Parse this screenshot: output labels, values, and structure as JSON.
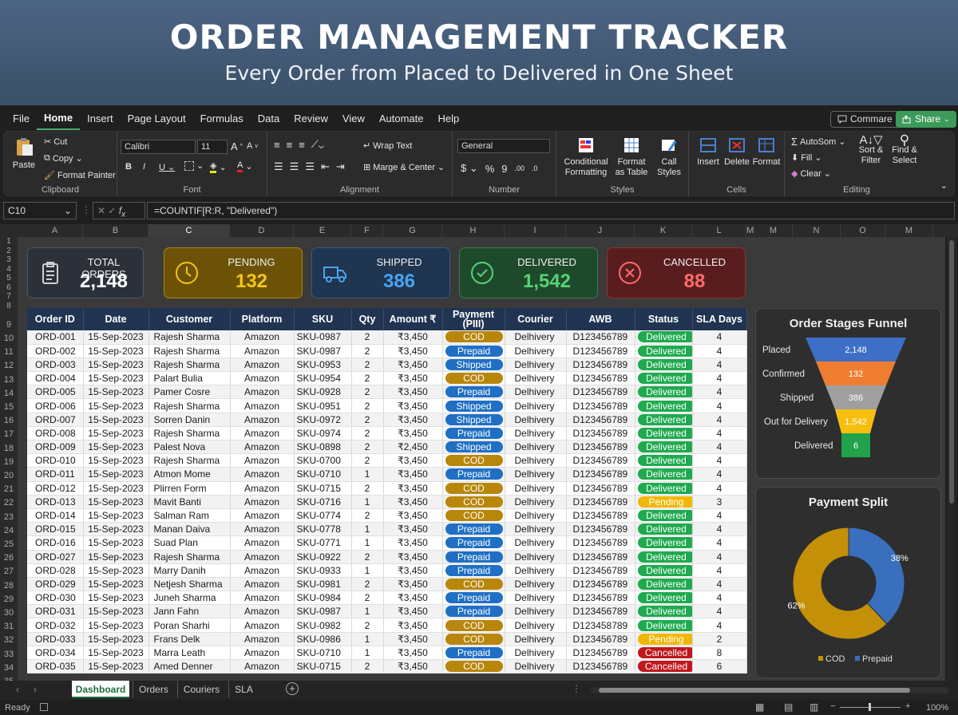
{
  "banner": {
    "title": "ORDER MANAGEMENT TRACKER",
    "subtitle": "Every Order from Placed to Delivered in One Sheet"
  },
  "menu": [
    "File",
    "Home",
    "Insert",
    "Page Layout",
    "Formulas",
    "Data",
    "Review",
    "View",
    "Automate",
    "Help"
  ],
  "comments_label": "Commare",
  "share_label": "Share",
  "ribbon": {
    "clipboard": {
      "paste": "Paste",
      "cut": "Cut",
      "copy": "Copy",
      "format_painter": "Format Painter",
      "label": "Clipboard"
    },
    "font": {
      "name": "Calibri",
      "size": "11",
      "label": "Font"
    },
    "alignment": {
      "wrap": "Wrap Text",
      "merge": "Marge & Center",
      "label": "Alignment"
    },
    "number": {
      "format": "General",
      "label": "Number"
    },
    "styles": {
      "conditional": "Conditional Formatting",
      "format_table": "Format as Table",
      "cell_styles": "Call Styles",
      "label": "Styles"
    },
    "cells": {
      "insert": "Insert",
      "delete": "Delete",
      "format": "Format",
      "label": "Cells"
    },
    "editing": {
      "autosum": "AutoSom",
      "fill": "Fill",
      "clear": "Clear",
      "sort": "Sort & Filter",
      "find": "Find & Select",
      "label": "Editing"
    }
  },
  "namebox": "C10",
  "formula": "=COUNTIF[R:R, \"Delivered\")",
  "columns": [
    "A",
    "B",
    "C",
    "D",
    "E",
    "F",
    "G",
    "H",
    "I",
    "J",
    "K",
    "L",
    "M",
    "M",
    "N",
    "O",
    "M"
  ],
  "cards": [
    {
      "label": "TOTAL ORDERS",
      "value": "2,148",
      "bg": "#2b3039",
      "border": "#505866",
      "color": "#ffffff",
      "icon": "clipboard-icon"
    },
    {
      "label": "PENDING",
      "value": "132",
      "bg": "#6b5206",
      "border": "#a88512",
      "color": "#f5c518",
      "icon": "clock-icon"
    },
    {
      "label": "SHIPPED",
      "value": "386",
      "bg": "#1f3550",
      "border": "#3a5a82",
      "color": "#4aa3f0",
      "icon": "truck-icon"
    },
    {
      "label": "DELIVERED",
      "value": "1,542",
      "bg": "#1e4a2c",
      "border": "#3b7a4f",
      "color": "#58d277",
      "icon": "check-icon"
    },
    {
      "label": "CANCELLED",
      "value": "88",
      "bg": "#5a1d1f",
      "border": "#8a3538",
      "color": "#ff6b6b",
      "icon": "x-circle-icon"
    }
  ],
  "table": {
    "headers": [
      "Order ID",
      "Date",
      "Customer",
      "Platform",
      "SKU",
      "Qty",
      "Amount ₹",
      "Payment (PIII)",
      "Courier",
      "AWB",
      "Status",
      "SLA Days"
    ],
    "rows": [
      [
        "ORD-001",
        "15-Sep-2023",
        "Rajesh Sharma",
        "Amazon",
        "SKU-0987",
        "2",
        "₹3,450",
        "COD",
        "Delhivery",
        "D123456789",
        "Delivered",
        "4"
      ],
      [
        "ORD-002",
        "15-Sep-2023",
        "Rajesh Sharma",
        "Amazon",
        "SKU-0987",
        "2",
        "₹3,450",
        "Prepaid",
        "Delhivery",
        "D123456789",
        "Delivered",
        "4"
      ],
      [
        "ORD-003",
        "15-Sep-2023",
        "Rajesh Sharma",
        "Amazon",
        "SKU-0953",
        "2",
        "₹3,450",
        "Shipped",
        "Delhivery",
        "D123456789",
        "Delivered",
        "4"
      ],
      [
        "ORD-004",
        "15-Sep-2023",
        "Palart Bulia",
        "Amazon",
        "SKU-0954",
        "2",
        "₹3,450",
        "COD",
        "Delhivery",
        "D123456789",
        "Delivered",
        "4"
      ],
      [
        "ORD-005",
        "15-Sep-2023",
        "Pamer Cosre",
        "Amazon",
        "SKU-0928",
        "2",
        "₹3,450",
        "Prepaid",
        "Delhivery",
        "D123456789",
        "Delivered",
        "4"
      ],
      [
        "ORD-006",
        "15-Sep-2023",
        "Rajesh Sharma",
        "Amazon",
        "SKU-0951",
        "2",
        "₹3,450",
        "Shipped",
        "Delhivery",
        "D123456789",
        "Delivered",
        "4"
      ],
      [
        "ORD-007",
        "15-Sep-2023",
        "Sorren Danin",
        "Amazon",
        "SKU-0972",
        "2",
        "₹3,450",
        "Shipped",
        "Delhivery",
        "D123456789",
        "Delivered",
        "4"
      ],
      [
        "ORD-008",
        "15-Sep-2023",
        "Rajesh Sharma",
        "Amazon",
        "SKU-0974",
        "2",
        "₹3,450",
        "Prepaid",
        "Delhivery",
        "D123456789",
        "Delivered",
        "4"
      ],
      [
        "ORD-009",
        "15-Sep-2023",
        "Palest Nova",
        "Amazon",
        "SKU-0898",
        "2",
        "₹2,450",
        "Shipped",
        "Delhivery",
        "D123456789",
        "Delivered",
        "4"
      ],
      [
        "ORD-010",
        "15-Sep-2023",
        "Rajesh Sharma",
        "Amazon",
        "SKU-0700",
        "2",
        "₹3,450",
        "COD",
        "Delhivery",
        "D123456789",
        "Delivered",
        "4"
      ],
      [
        "ORD-011",
        "15-Sep-2023",
        "Atmon Mome",
        "Amazon",
        "SKU-0710",
        "1",
        "₹3,450",
        "Prepaid",
        "Delhivery",
        "D123456789",
        "Delivered",
        "4"
      ],
      [
        "ORD-012",
        "15-Sep-2023",
        "Plirren Form",
        "Amazon",
        "SKU-0715",
        "2",
        "₹3,450",
        "COD",
        "Delhivery",
        "D123456789",
        "Delivered",
        "4"
      ],
      [
        "ORD-013",
        "15-Sep-2023",
        "Mavit Banti",
        "Amazon",
        "SKU-0716",
        "1",
        "₹3,450",
        "COD",
        "Delhivery",
        "D123456789",
        "Pending",
        "3"
      ],
      [
        "ORD-014",
        "15-Sep-2023",
        "Salman Ram",
        "Amazon",
        "SKU-0774",
        "2",
        "₹3,450",
        "COD",
        "Delhivery",
        "D123456789",
        "Delivered",
        "4"
      ],
      [
        "ORD-015",
        "15-Sep-2023",
        "Manan Daiva",
        "Amazon",
        "SKU-0778",
        "1",
        "₹3,450",
        "Prepaid",
        "Delhivery",
        "D123456789",
        "Delivered",
        "4"
      ],
      [
        "ORD-016",
        "15-Sep-2023",
        "Suad Plan",
        "Amazon",
        "SKU-0771",
        "1",
        "₹3,450",
        "Prepaid",
        "Delhivery",
        "D123456789",
        "Delivered",
        "4"
      ],
      [
        "ORD-027",
        "15-Sep-2023",
        "Rajesh Sharma",
        "Amazon",
        "SKU-0922",
        "2",
        "₹3,450",
        "Prepaid",
        "Delhivery",
        "D123456789",
        "Delivered",
        "4"
      ],
      [
        "ORD-028",
        "15-Sep-2023",
        "Marry Danih",
        "Amazon",
        "SKU-0933",
        "1",
        "₹3,450",
        "Prepaid",
        "Delhivery",
        "D123456789",
        "Delivered",
        "4"
      ],
      [
        "ORD-029",
        "15-Sep-2023",
        "Netjesh Sharma",
        "Amazon",
        "SKU-0981",
        "2",
        "₹3,450",
        "COD",
        "Delhivery",
        "D123456789",
        "Delivered",
        "4"
      ],
      [
        "ORD-030",
        "15-Sep-2023",
        "Juneh Sharma",
        "Amazon",
        "SKU-0984",
        "2",
        "₹3,450",
        "Prepaid",
        "Delhivery",
        "D123456789",
        "Delivered",
        "4"
      ],
      [
        "ORD-031",
        "15-Sep-2023",
        "Jann Fahn",
        "Amazon",
        "SKU-0987",
        "1",
        "₹3,450",
        "Prepaid",
        "Delhivery",
        "D123456789",
        "Delivered",
        "4"
      ],
      [
        "ORD-032",
        "15-Sep-2023",
        "Poran Sharhi",
        "Amazon",
        "SKU-0982",
        "2",
        "₹3,450",
        "COD",
        "Delhivery",
        "D123458789",
        "Delivered",
        "4"
      ],
      [
        "ORD-033",
        "15-Sep-2023",
        "Frans Delk",
        "Amazon",
        "SKU-0986",
        "1",
        "₹3,450",
        "COD",
        "Delhivery",
        "D123456789",
        "Pending",
        "2"
      ],
      [
        "ORD-034",
        "15-Sep-2023",
        "Marra Leath",
        "Amazon",
        "SKU-0710",
        "1",
        "₹3,450",
        "Prepaid",
        "Delhivery",
        "D123456789",
        "Cancelled",
        "8"
      ],
      [
        "ORD-035",
        "15-Sep-2023",
        "Amed Denner",
        "Amazon",
        "SKU-0715",
        "2",
        "₹3,450",
        "COD",
        "Delhivery",
        "D123456789",
        "Cancelled",
        "6"
      ]
    ]
  },
  "pill_colors": {
    "COD": "#b8860b",
    "Prepaid": "#1f6fc5",
    "Shipped": "#1f6fc5",
    "Delivered": "#1faa4f",
    "Pending": "#f2b705",
    "Cancelled": "#c0171c"
  },
  "funnel": {
    "title": "Order Stages Funnel",
    "stages": [
      {
        "label": "Placed",
        "value": "2,148",
        "color": "#3f6ec6"
      },
      {
        "label": "Confirmed",
        "value": "132",
        "color": "#ee7d31"
      },
      {
        "label": "Shipped",
        "value": "386",
        "color": "#9f9f9f"
      },
      {
        "label": "Out for Delivery",
        "value": "1,542",
        "color": "#f6bf10"
      },
      {
        "label": "Delivered",
        "value": "6",
        "color": "#22a24a"
      }
    ]
  },
  "chart_data": {
    "type": "pie",
    "title": "Payment Split",
    "categories": [
      "COD",
      "Prepaid"
    ],
    "values": [
      62,
      38
    ],
    "labels": [
      "62%",
      "38%"
    ],
    "colors": [
      "#c39008",
      "#3a6fbe"
    ],
    "legend": "bottom"
  },
  "tabs": [
    "Dashboard",
    "Orders",
    "Couriers",
    "SLA"
  ],
  "status": {
    "ready": "Ready",
    "zoom": "100%"
  }
}
